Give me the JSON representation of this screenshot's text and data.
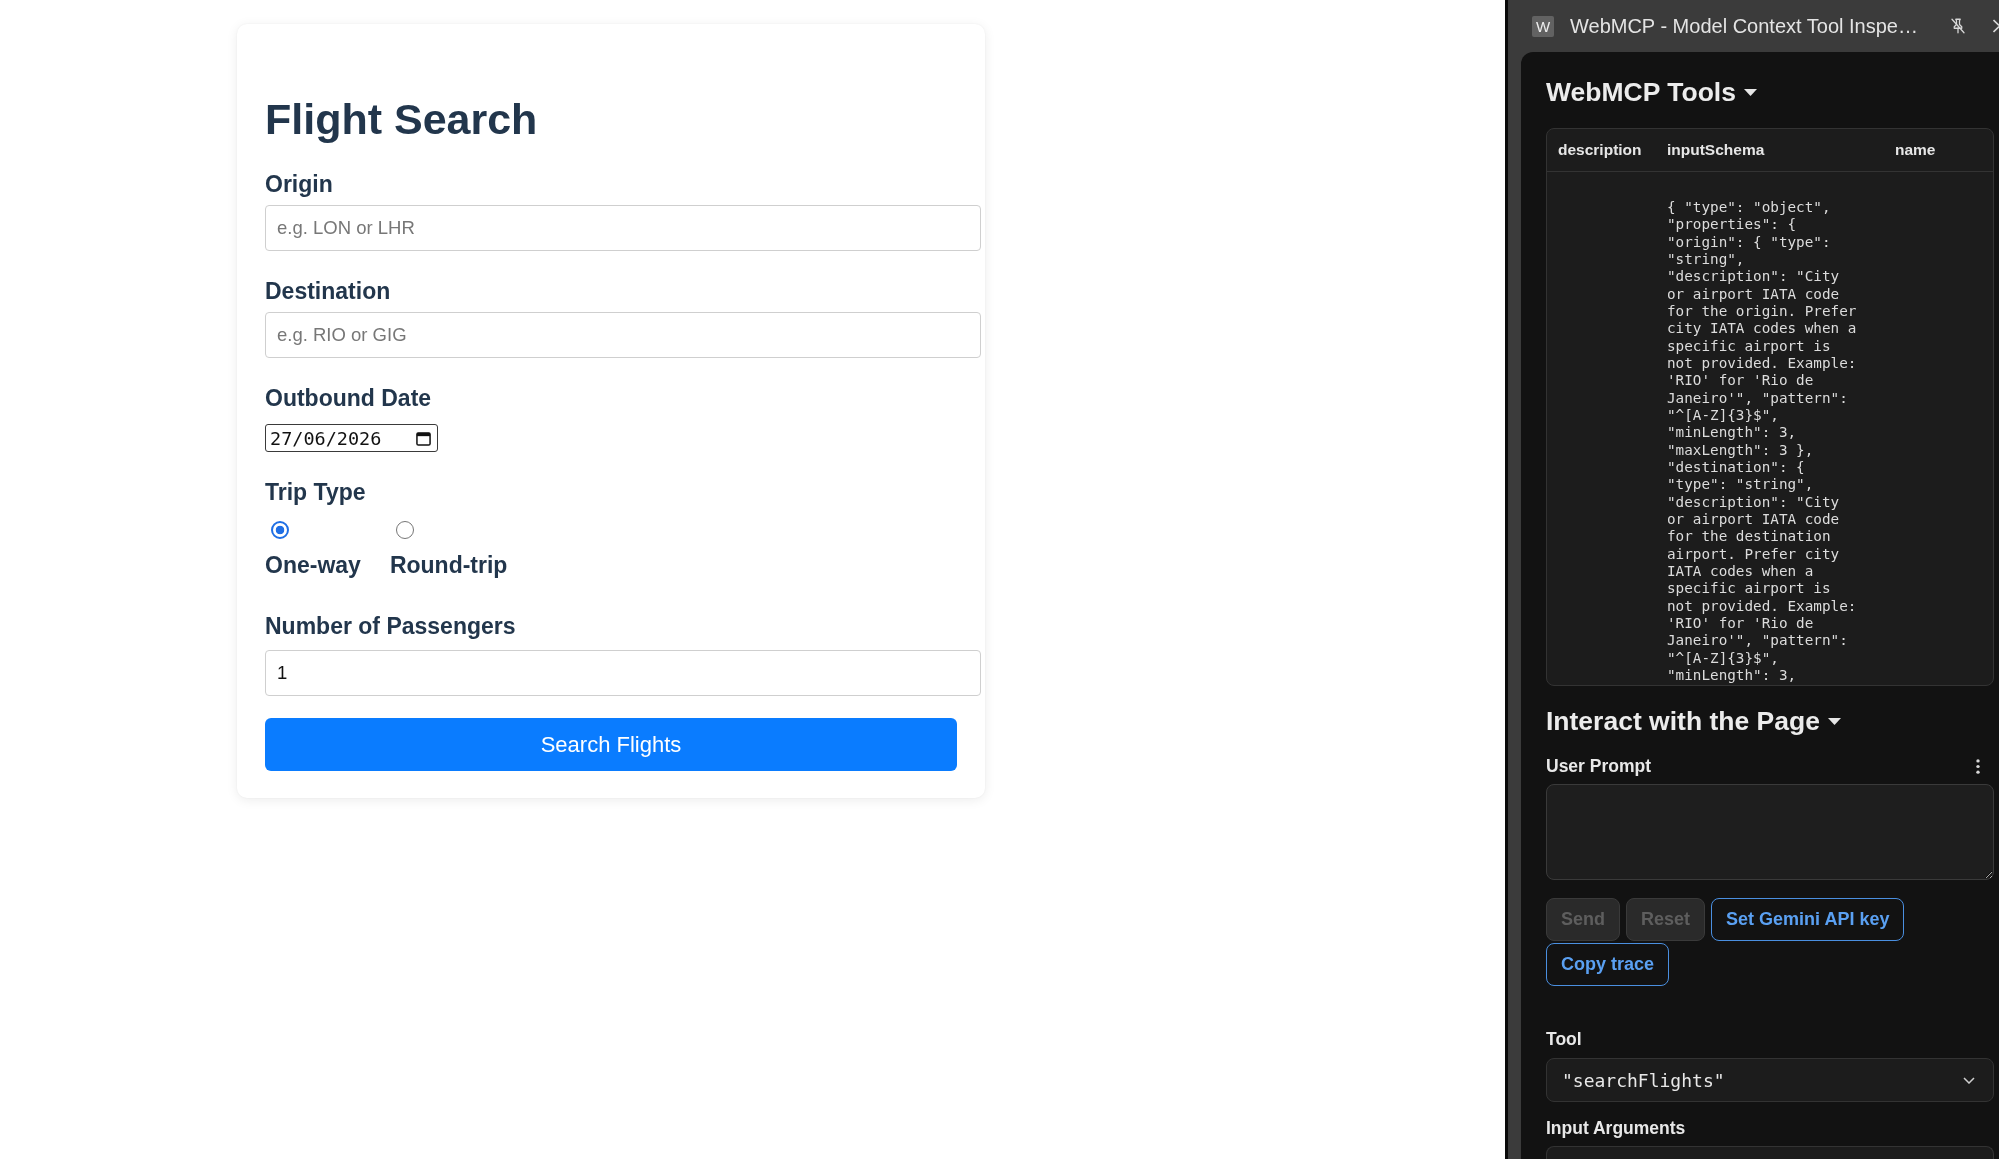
{
  "flight_form": {
    "title": "Flight Search",
    "fields": [
      {
        "kind": "text",
        "label": "Origin",
        "placeholder": "e.g. LON or LHR"
      },
      {
        "kind": "text",
        "label": "Destination",
        "placeholder": "e.g. RIO or GIG"
      },
      {
        "kind": "date",
        "label": "Outbound Date",
        "value": "27/06/2026"
      },
      {
        "kind": "radio",
        "label": "Trip Type",
        "options": [
          {
            "label": "One-way",
            "selected": true
          },
          {
            "label": "Round-trip",
            "selected": false
          }
        ]
      },
      {
        "kind": "number",
        "label": "Number of Passengers",
        "value": "1"
      }
    ],
    "submit_button": "Search Flights"
  },
  "inspector": {
    "window": {
      "app_icon": "W",
      "title": "WebMCP - Model Context Tool Inspe…"
    },
    "tools_section": {
      "heading": "WebMCP Tools",
      "expanded": true,
      "table": {
        "columns": [
          {
            "header": "description"
          },
          {
            "header": "inputSchema",
            "cells": [
              "{ \"type\": \"object\", \"properties\": { \"origin\": { \"type\": \"string\", \"description\": \"City or airport IATA code for the origin. Prefer city IATA codes when a specific airport is not provided. Example: 'RIO' for 'Rio de Janeiro'\", \"pattern\": \"^[A-Z]{3}$\", \"minLength\": 3, \"maxLength\": 3 }, \"destination\": { \"type\": \"string\", \"description\": \"City or airport IATA code for the destination airport. Prefer city IATA codes when a specific airport is not provided. Example: 'RIO' for 'Rio de Janeiro'\", \"pattern\": \"^[A-Z]{3}$\", \"minLength\": 3,"
            ]
          },
          {
            "header": "name"
          }
        ]
      }
    },
    "interact_section": {
      "heading": "Interact with the Page",
      "expanded": true,
      "prompt_label": "User Prompt",
      "buttons": [
        {
          "label": "Send",
          "disabled": true
        },
        {
          "label": "Reset",
          "disabled": true
        },
        {
          "label": "Set Gemini API key",
          "disabled": false
        },
        {
          "label": "Copy trace",
          "disabled": false
        }
      ],
      "tool_label": "Tool",
      "tool_select": {
        "value": "\"searchFlights\""
      },
      "arguments_label": "Input Arguments"
    }
  }
}
